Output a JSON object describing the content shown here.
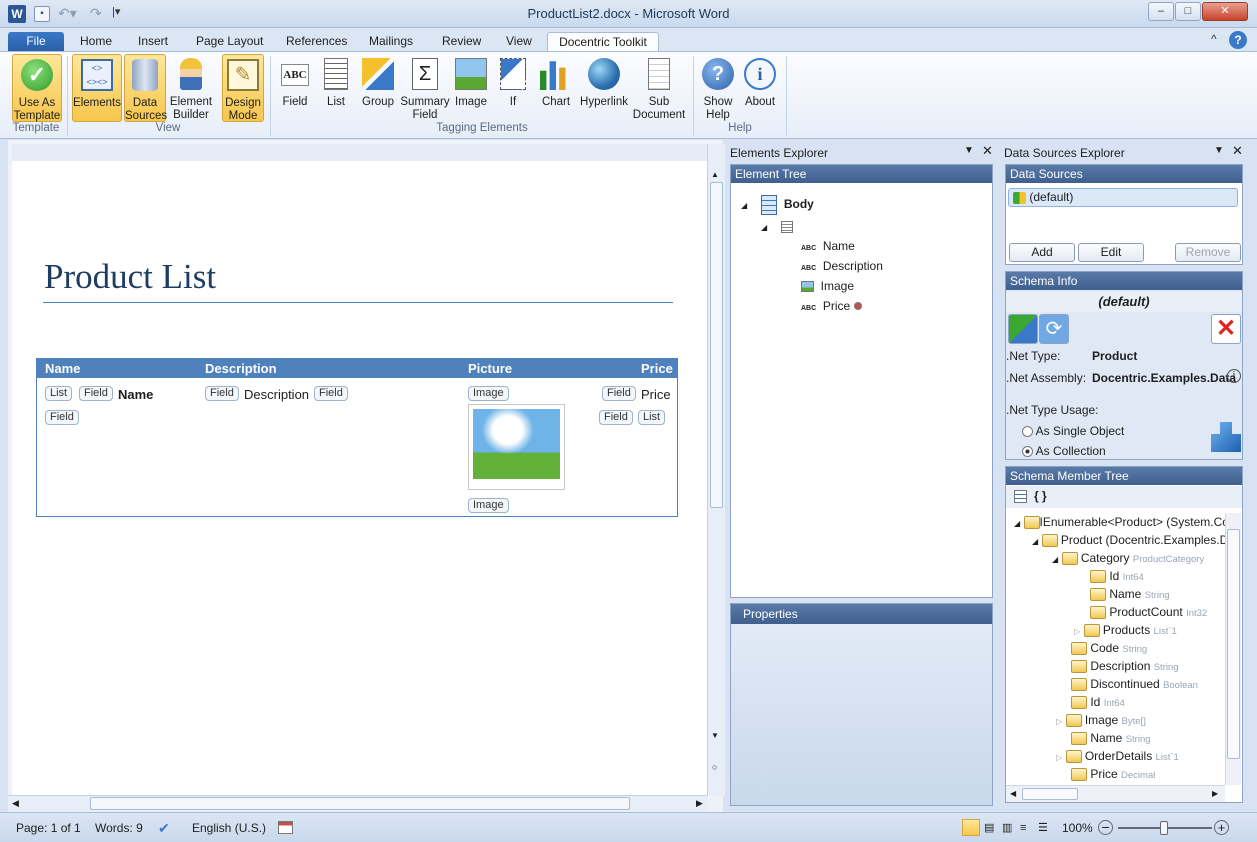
{
  "window": {
    "title": "ProductList2.docx - Microsoft Word",
    "minimize": "–",
    "maximize": "□",
    "close": "✕",
    "help": "?",
    "collapse": "^"
  },
  "tabs": {
    "file": "File",
    "home": "Home",
    "insert": "Insert",
    "page_layout": "Page Layout",
    "references": "References",
    "mailings": "Mailings",
    "review": "Review",
    "view": "View",
    "docentric": "Docentric Toolkit"
  },
  "ribbon": {
    "use_as_template": "Use As Template",
    "elements": "Elements",
    "data_sources": "Data Sources",
    "element_builder": "Element Builder",
    "design_mode": "Design Mode",
    "field": "Field",
    "list": "List",
    "group": "Group",
    "summary_field": "Summary Field",
    "image": "Image",
    "if": "If",
    "chart": "Chart",
    "hyperlink": "Hyperlink",
    "sub_document": "Sub Document",
    "show_help": "Show Help",
    "about": "About",
    "groups": {
      "template": "Template",
      "view": "View",
      "tagging": "Tagging Elements",
      "help": "Help"
    }
  },
  "document": {
    "heading": "Product List",
    "table_headers": {
      "name": "Name",
      "description": "Description",
      "picture": "Picture",
      "price": "Price"
    },
    "chips": {
      "list": "List",
      "field": "Field",
      "image": "Image"
    },
    "cells": {
      "name": "Name",
      "description": "Description",
      "price": "Price"
    }
  },
  "elements_explorer": {
    "title": "Elements Explorer",
    "tree_title": "Element Tree",
    "body": "Body",
    "items": [
      "Name",
      "Description",
      "Image",
      "Price"
    ],
    "properties": "Properties"
  },
  "data_sources_explorer": {
    "title": "Data Sources Explorer",
    "section": "Data Sources",
    "default": "(default)",
    "add": "Add",
    "edit": "Edit",
    "remove": "Remove",
    "schema_info": "Schema Info",
    "schema_name": "(default)",
    "net_type_label": ".Net Type:",
    "net_type": "Product",
    "net_assembly_label": ".Net Assembly:",
    "net_assembly": "Docentric.Examples.Data",
    "usage_label": ".Net Type Usage:",
    "single": "As Single Object",
    "collection": "As Collection",
    "member_tree": "Schema Member Tree",
    "braces": "{ }",
    "members": [
      {
        "name": "IEnumerable<Product> (System.Co",
        "type": ""
      },
      {
        "name": "Product (Docentric.Examples.D",
        "type": ""
      },
      {
        "name": "Category",
        "type": "ProductCategory"
      },
      {
        "name": "Id",
        "type": "Int64"
      },
      {
        "name": "Name",
        "type": "String"
      },
      {
        "name": "ProductCount",
        "type": "Int32"
      },
      {
        "name": "Products",
        "type": "List`1"
      },
      {
        "name": "Code",
        "type": "String"
      },
      {
        "name": "Description",
        "type": "String"
      },
      {
        "name": "Discontinued",
        "type": "Boolean"
      },
      {
        "name": "Id",
        "type": "Int64"
      },
      {
        "name": "Image",
        "type": "Byte[]"
      },
      {
        "name": "Name",
        "type": "String"
      },
      {
        "name": "OrderDetails",
        "type": "List`1"
      },
      {
        "name": "Price",
        "type": "Decimal"
      }
    ]
  },
  "status": {
    "page": "Page: 1 of 1",
    "words": "Words: 9",
    "language": "English (U.S.)",
    "zoom": "100%"
  }
}
